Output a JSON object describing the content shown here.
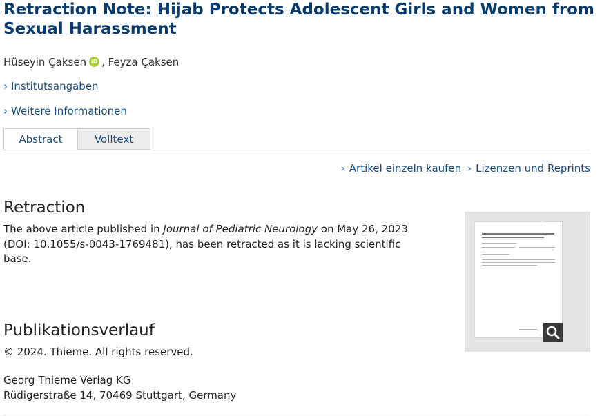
{
  "article": {
    "title": "Retraction Note: Hijab Protects Adolescent Girls and Women from Sexual Harassment",
    "authors": [
      {
        "name": "Hüseyin Çaksen",
        "orcid_icon": "iD"
      },
      {
        "name": "Feyza Çaksen"
      }
    ],
    "author_separator": ","
  },
  "expanders": {
    "institution": {
      "chevron": "›",
      "label": "Institutsangaben"
    },
    "more_info": {
      "chevron": "›",
      "label": "Weitere Informationen"
    }
  },
  "tabs": {
    "abstract": "Abstract",
    "fulltext": "Volltext",
    "active": "Abstract"
  },
  "actions": {
    "buy": {
      "chevron": "›",
      "label": "Artikel einzeln kaufen"
    },
    "licenses": {
      "chevron": "›",
      "label": "Lizenzen und Reprints"
    }
  },
  "retraction": {
    "heading": "Retraction",
    "text_pre": "The above article published in ",
    "journal": "Journal of Pediatric Neurology",
    "text_post": " on May 26, 2023 (DOI: 10.1055/s-0043-1769481), has been retracted as it is lacking scientific base."
  },
  "thumbnail": {
    "zoom_icon": "magnifier-icon"
  },
  "publication_history": {
    "heading": "Publikationsverlauf",
    "copyright": "© 2024. Thieme. All rights reserved.",
    "publisher_name": "Georg Thieme Verlag KG",
    "publisher_address": "Rüdigerstraße 14, 70469 Stuttgart, Germany"
  },
  "colors": {
    "title": "#0a3d6e",
    "link": "#1a4d7d",
    "orcid": "#a6ce39",
    "chevron_accent": "#4c86c5"
  }
}
